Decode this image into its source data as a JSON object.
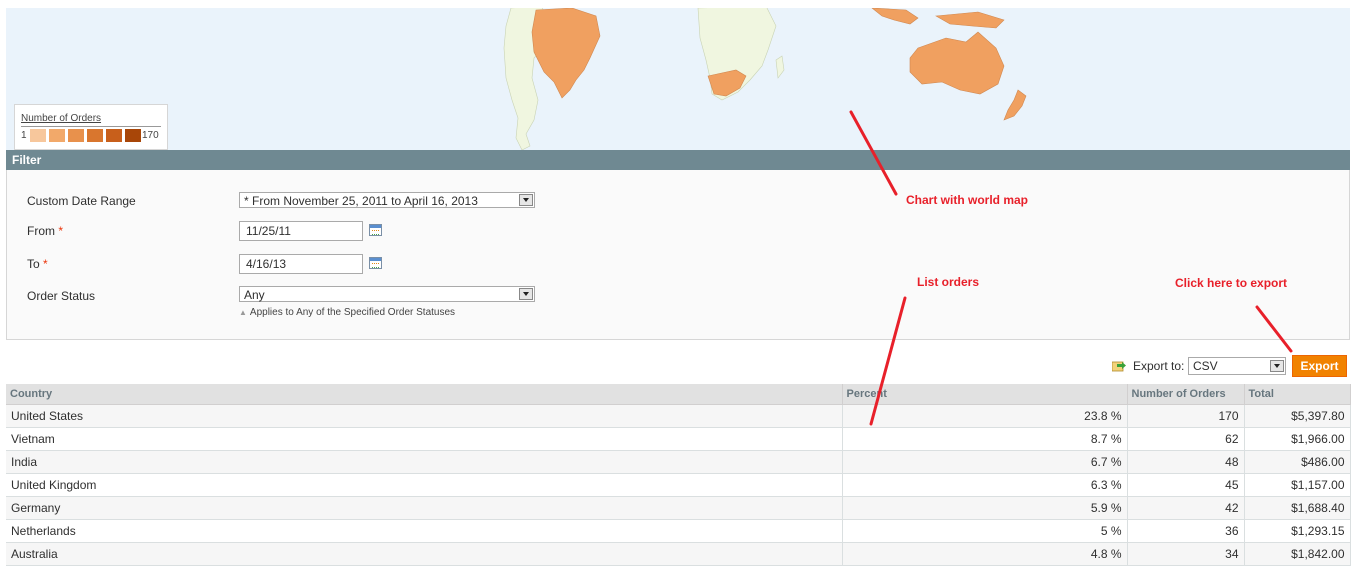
{
  "map": {
    "legend_title": "Number of Orders",
    "legend_min": "1",
    "legend_max": "170",
    "scale_colors": [
      "#f7c79c",
      "#f2a96a",
      "#e8914c",
      "#d9762e",
      "#c85f1b",
      "#a84608"
    ],
    "ocean_color": "#eaf3fb",
    "land_color": "#f0f6e0",
    "highlight_color": "#f0a060"
  },
  "filter": {
    "header": "Filter",
    "date_range_label": "Custom Date Range",
    "date_range_value": "* From November 25, 2011 to April 16, 2013",
    "from_label": "From",
    "from_value": "11/25/11",
    "to_label": "To",
    "to_value": "4/16/13",
    "required_mark": "*",
    "status_label": "Order Status",
    "status_value": "Any",
    "status_note": "Applies to Any of the Specified Order Statuses"
  },
  "export": {
    "label": "Export to:",
    "format": "CSV",
    "button": "Export"
  },
  "table": {
    "columns": [
      "Country",
      "Percent",
      "Number of Orders",
      "Total"
    ],
    "rows": [
      {
        "country": "United States",
        "percent": "23.8 %",
        "orders": "170",
        "total": "$5,397.80"
      },
      {
        "country": "Vietnam",
        "percent": "8.7 %",
        "orders": "62",
        "total": "$1,966.00"
      },
      {
        "country": "India",
        "percent": "6.7 %",
        "orders": "48",
        "total": "$486.00"
      },
      {
        "country": "United Kingdom",
        "percent": "6.3 %",
        "orders": "45",
        "total": "$1,157.00"
      },
      {
        "country": "Germany",
        "percent": "5.9 %",
        "orders": "42",
        "total": "$1,688.40"
      },
      {
        "country": "Netherlands",
        "percent": "5 %",
        "orders": "36",
        "total": "$1,293.15"
      },
      {
        "country": "Australia",
        "percent": "4.8 %",
        "orders": "34",
        "total": "$1,842.00"
      }
    ]
  },
  "annotations": {
    "map_note": "Chart with world map",
    "list_note": "List orders",
    "export_note": "Click here to export",
    "color": "#e8202a"
  }
}
